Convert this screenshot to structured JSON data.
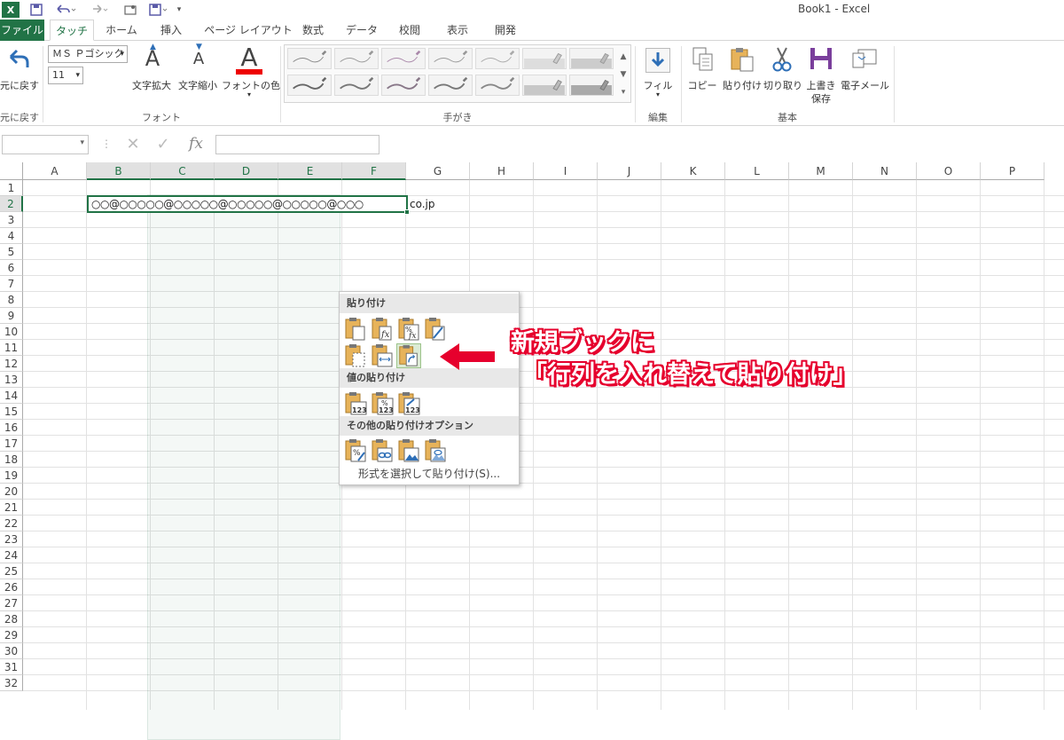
{
  "window": {
    "title": "Book1 - Excel"
  },
  "quick_access": {
    "save_icon": "save-icon",
    "undo_icon": "undo-icon",
    "redo_icon": "redo-icon",
    "touch_icon": "touch-mode-icon",
    "customize_icon": "customize-icon"
  },
  "tabs": [
    "ファイル",
    "タッチ",
    "ホーム",
    "挿入",
    "ページ レイアウト",
    "数式",
    "データ",
    "校閲",
    "表示",
    "開発"
  ],
  "ribbon": {
    "undo_label": "元に戻す",
    "undo_group": "元に戻す",
    "font_name": "ＭＳ Ｐゴシック",
    "font_size": "11",
    "grow_font": "文字拡大",
    "shrink_font": "文字縮小",
    "font_color": "フォントの色",
    "font_group": "フォント",
    "ink_group": "手がき",
    "fill_label": "フィル",
    "edit_group": "編集",
    "copy": "コピー",
    "paste": "貼り付け",
    "cut": "切り取り",
    "save_line1": "上書き",
    "save_line2": "保存",
    "email": "電子メール",
    "basic_group": "基本"
  },
  "formula_bar": {
    "cancel_glyph": "✕",
    "enter_glyph": "✓",
    "fx_glyph": "fx",
    "content": ""
  },
  "grid": {
    "columns": [
      "A",
      "B",
      "C",
      "D",
      "E",
      "F",
      "G",
      "H",
      "I",
      "J",
      "K",
      "L",
      "M",
      "N",
      "O",
      "P"
    ],
    "rows": [
      "1",
      "2",
      "3",
      "4",
      "5",
      "6",
      "7",
      "8",
      "9",
      "10",
      "11",
      "12",
      "13",
      "14",
      "15",
      "16",
      "17",
      "18",
      "19",
      "20",
      "21",
      "22",
      "23",
      "24",
      "25",
      "26",
      "27",
      "28",
      "29",
      "30",
      "31",
      "32"
    ],
    "cell_b2": "○○@○○○○○@○○○○○@○○○○○@○○○○○@○○○",
    "cell_overflow": "co.jp"
  },
  "context_menu": {
    "paste_header": "貼り付け",
    "values_header": "値の貼り付け",
    "other_header": "その他の貼り付けオプション",
    "paste_special": "形式を選択して貼り付け(S)...",
    "icon_label_123": "123",
    "icon_label_pct": "%",
    "icon_label_fx": "fx"
  },
  "annotation": {
    "line1": "新規ブックに",
    "line2": "「行列を入れ替えて貼り付け」",
    "color": "#e6002d"
  },
  "colors": {
    "accent": "#217346",
    "ribbon_border": "#d5d5d5"
  }
}
